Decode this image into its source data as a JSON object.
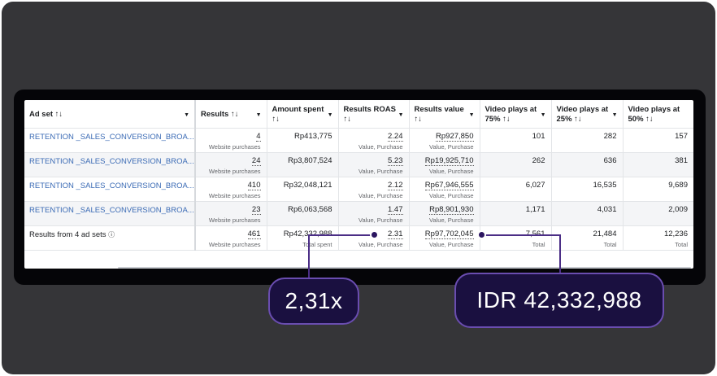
{
  "columns": [
    {
      "label": "Ad set ↑↓"
    },
    {
      "label": "Results ↑↓"
    },
    {
      "label": "Amount spent",
      "label2": "↑↓"
    },
    {
      "label": "Results ROAS",
      "label2": "↑↓"
    },
    {
      "label": "Results value",
      "label2": "↑↓"
    },
    {
      "label": "Video plays at",
      "label2": "75% ↑↓"
    },
    {
      "label": "Video plays at",
      "label2": "25% ↑↓"
    },
    {
      "label": "Video plays at",
      "label2": "50% ↑↓"
    }
  ],
  "rows": [
    {
      "name": "RETENTION _SALES_CONVERSION_BROA...",
      "results": "4",
      "results_sub": "Website purchases",
      "spent": "Rp413,775",
      "roas": "2.24",
      "roas_sub": "Value, Purchase",
      "value": "Rp927,850",
      "value_sub": "Value, Purchase",
      "v75": "101",
      "v25": "282",
      "v50": "157"
    },
    {
      "name": "RETENTION _SALES_CONVERSION_BROA...",
      "results": "24",
      "results_sub": "Website purchases",
      "spent": "Rp3,807,524",
      "roas": "5.23",
      "roas_sub": "Value, Purchase",
      "value": "Rp19,925,710",
      "value_sub": "Value, Purchase",
      "v75": "262",
      "v25": "636",
      "v50": "381"
    },
    {
      "name": "RETENTION _SALES_CONVERSION_BROA...",
      "results": "410",
      "results_sub": "Website purchases",
      "spent": "Rp32,048,121",
      "roas": "2.12",
      "roas_sub": "Value, Purchase",
      "value": "Rp67,946,555",
      "value_sub": "Value, Purchase",
      "v75": "6,027",
      "v25": "16,535",
      "v50": "9,689"
    },
    {
      "name": "RETENTION _SALES_CONVERSION_BROA...",
      "results": "23",
      "results_sub": "Website purchases",
      "spent": "Rp6,063,568",
      "roas": "1.47",
      "roas_sub": "Value, Purchase",
      "value": "Rp8,901,930",
      "value_sub": "Value, Purchase",
      "v75": "1,171",
      "v25": "4,031",
      "v50": "2,009"
    }
  ],
  "total": {
    "name": "Results from 4 ad sets",
    "results": "461",
    "results_sub": "Website purchases",
    "spent": "Rp42,332,988",
    "spent_sub": "Total spent",
    "roas": "2.31",
    "roas_sub": "Value, Purchase",
    "value": "Rp97,702,045",
    "value_sub": "Value, Purchase",
    "v75": "7,561",
    "v75_sub": "Total",
    "v25": "21,484",
    "v25_sub": "Total",
    "v50": "12,236",
    "v50_sub": "Total"
  },
  "callouts": {
    "roas": "2,31x",
    "spent": "IDR 42,332,988"
  },
  "colors": {
    "link": "#3b6bb5",
    "pill_bg": "#1a1040",
    "pill_border": "#6a4db0",
    "connector": "#4b2e86"
  }
}
